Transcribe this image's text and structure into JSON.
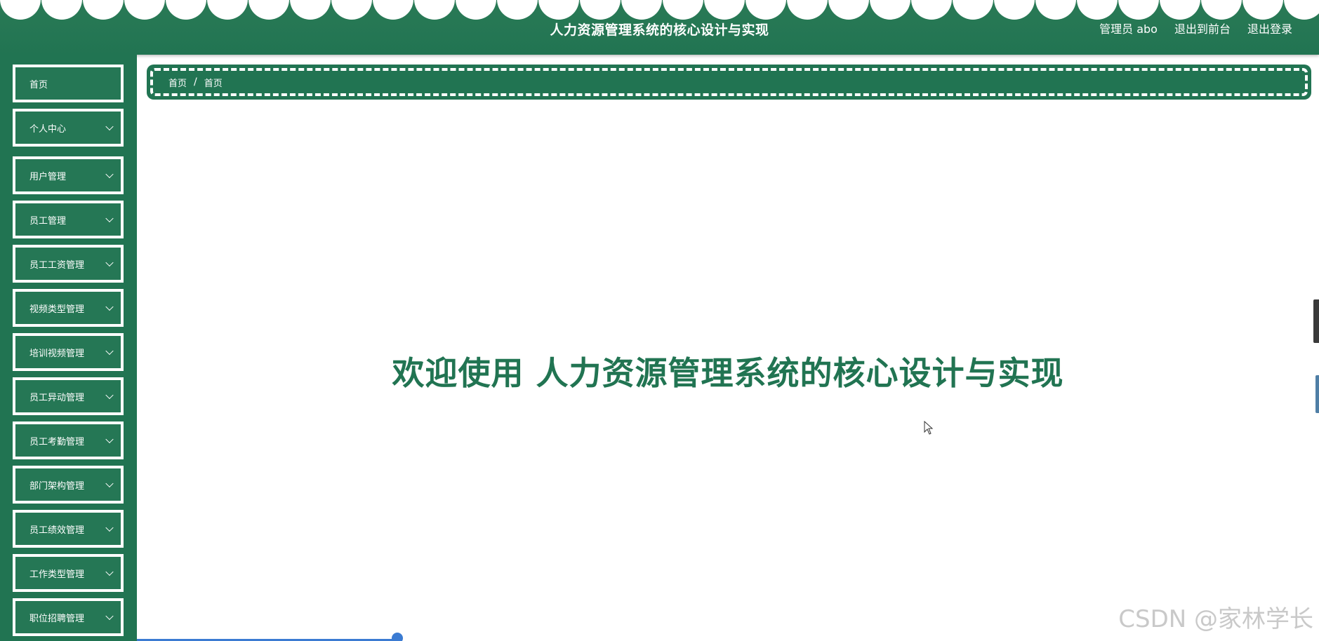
{
  "header": {
    "title": "人力资源管理系统的核心设计与实现",
    "user_label": "管理员 abo",
    "front_link": "退出到前台",
    "logout_link": "退出登录"
  },
  "sidebar": {
    "items": [
      {
        "label": "首页",
        "has_submenu": false
      },
      {
        "label": "个人中心",
        "has_submenu": true
      },
      {
        "label": "用户管理",
        "has_submenu": true
      },
      {
        "label": "员工管理",
        "has_submenu": true
      },
      {
        "label": "员工工资管理",
        "has_submenu": true
      },
      {
        "label": "视频类型管理",
        "has_submenu": true
      },
      {
        "label": "培训视频管理",
        "has_submenu": true
      },
      {
        "label": "员工异动管理",
        "has_submenu": true
      },
      {
        "label": "员工考勤管理",
        "has_submenu": true
      },
      {
        "label": "部门架构管理",
        "has_submenu": true
      },
      {
        "label": "员工绩效管理",
        "has_submenu": true
      },
      {
        "label": "工作类型管理",
        "has_submenu": true
      },
      {
        "label": "职位招聘管理",
        "has_submenu": true
      }
    ]
  },
  "breadcrumb": {
    "items": [
      "首页",
      "首页"
    ],
    "separator": "/"
  },
  "main": {
    "welcome_text": "欢迎使用 人力资源管理系统的核心设计与实现"
  },
  "watermark": "CSDN @家林学长",
  "colors": {
    "primary": "#217452",
    "header": "#2a7a56",
    "text_on_primary": "#ffffff"
  }
}
